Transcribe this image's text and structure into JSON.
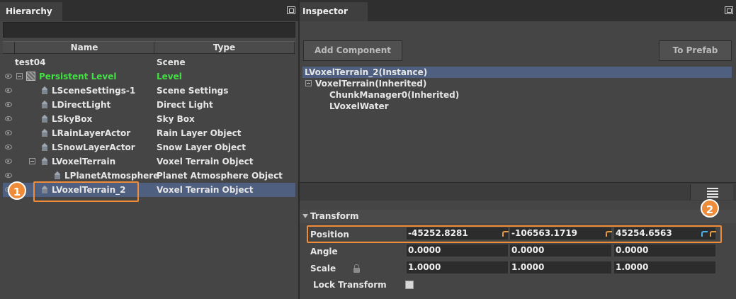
{
  "hierarchy": {
    "title": "Hierarchy",
    "columns": {
      "name": "Name",
      "type": "Type"
    },
    "rows": [
      {
        "name": "test04",
        "type": "Scene"
      },
      {
        "name": "Persistent Level",
        "type": "Level"
      },
      {
        "name": "LSceneSettings-1",
        "type": "Scene Settings"
      },
      {
        "name": "LDirectLight",
        "type": "Direct Light"
      },
      {
        "name": "LSkyBox",
        "type": "Sky Box"
      },
      {
        "name": "LRainLayerActor",
        "type": "Rain Layer Object"
      },
      {
        "name": "LSnowLayerActor",
        "type": "Snow Layer Object"
      },
      {
        "name": "LVoxelTerrain",
        "type": "Voxel Terrain Object"
      },
      {
        "name": "LPlanetAtmosphere",
        "type": "Planet Atmosphere Object"
      },
      {
        "name": "LVoxelTerrain_2",
        "type": "Voxel Terrain Object"
      }
    ]
  },
  "inspector": {
    "title": "Inspector",
    "add_component": "Add Component",
    "to_prefab": "To Prefab",
    "components": [
      "LVoxelTerrain_2(Instance)",
      "VoxelTerrain(Inherited)",
      "ChunkManager0(Inherited)",
      "LVoxelWater"
    ],
    "transform": {
      "title": "Transform",
      "position": {
        "label": "Position",
        "x": "-45252.8281",
        "y": "-106563.1719",
        "z": "45254.6563"
      },
      "angle": {
        "label": "Angle",
        "x": "0.0000",
        "y": "0.0000",
        "z": "0.0000"
      },
      "scale": {
        "label": "Scale",
        "x": "1.0000",
        "y": "1.0000",
        "z": "1.0000"
      },
      "lock": {
        "label": "Lock Transform"
      }
    }
  },
  "callouts": {
    "one": "1",
    "two": "2"
  },
  "colors": {
    "accent": "#ee8c3a",
    "selection": "#4e5f7f",
    "level_green": "#3fe23f",
    "revert_orange": "#e89a3c",
    "revert_blue": "#4ab2ea"
  }
}
